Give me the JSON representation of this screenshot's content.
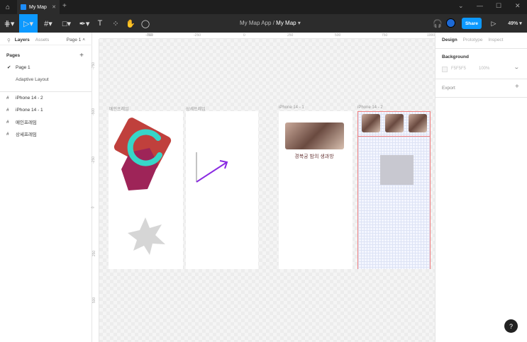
{
  "titlebar": {
    "tab_title": "My Map",
    "new_tab": "+",
    "minimize": "—",
    "maximize": "☐",
    "close": "✕",
    "menu": "⌄"
  },
  "toolbar": {
    "project": "My Map App",
    "separator": "/",
    "file": "My Map",
    "share": "Share",
    "zoom": "49%"
  },
  "left_panel": {
    "tabs": [
      "Layers",
      "Assets"
    ],
    "page_selector": "Page 1",
    "pages_title": "Pages",
    "pages": [
      "Page 1",
      "Adaptive Layout"
    ],
    "layers": [
      "iPhone 14 - 2",
      "iPhone 14 - 1",
      "메인프레임",
      "상세프레임"
    ]
  },
  "right_panel": {
    "tabs": [
      "Design",
      "Prototype",
      "Inspect"
    ],
    "background_title": "Background",
    "bg_color": "F5F5F5",
    "bg_opacity": "100%",
    "export": "Export"
  },
  "rulers": {
    "top": [
      "-750",
      "-500",
      "-250",
      "0",
      "250",
      "500",
      "750",
      "1000"
    ],
    "left": [
      "-750",
      "-500",
      "-250",
      "0",
      "250",
      "500"
    ]
  },
  "canvas": {
    "frames": [
      "메인프레임",
      "상세프레임",
      "iPhone 14 - 1",
      "iPhone 14 - 2"
    ],
    "card_title": "경복궁 밤의 생과방"
  },
  "help": "?"
}
